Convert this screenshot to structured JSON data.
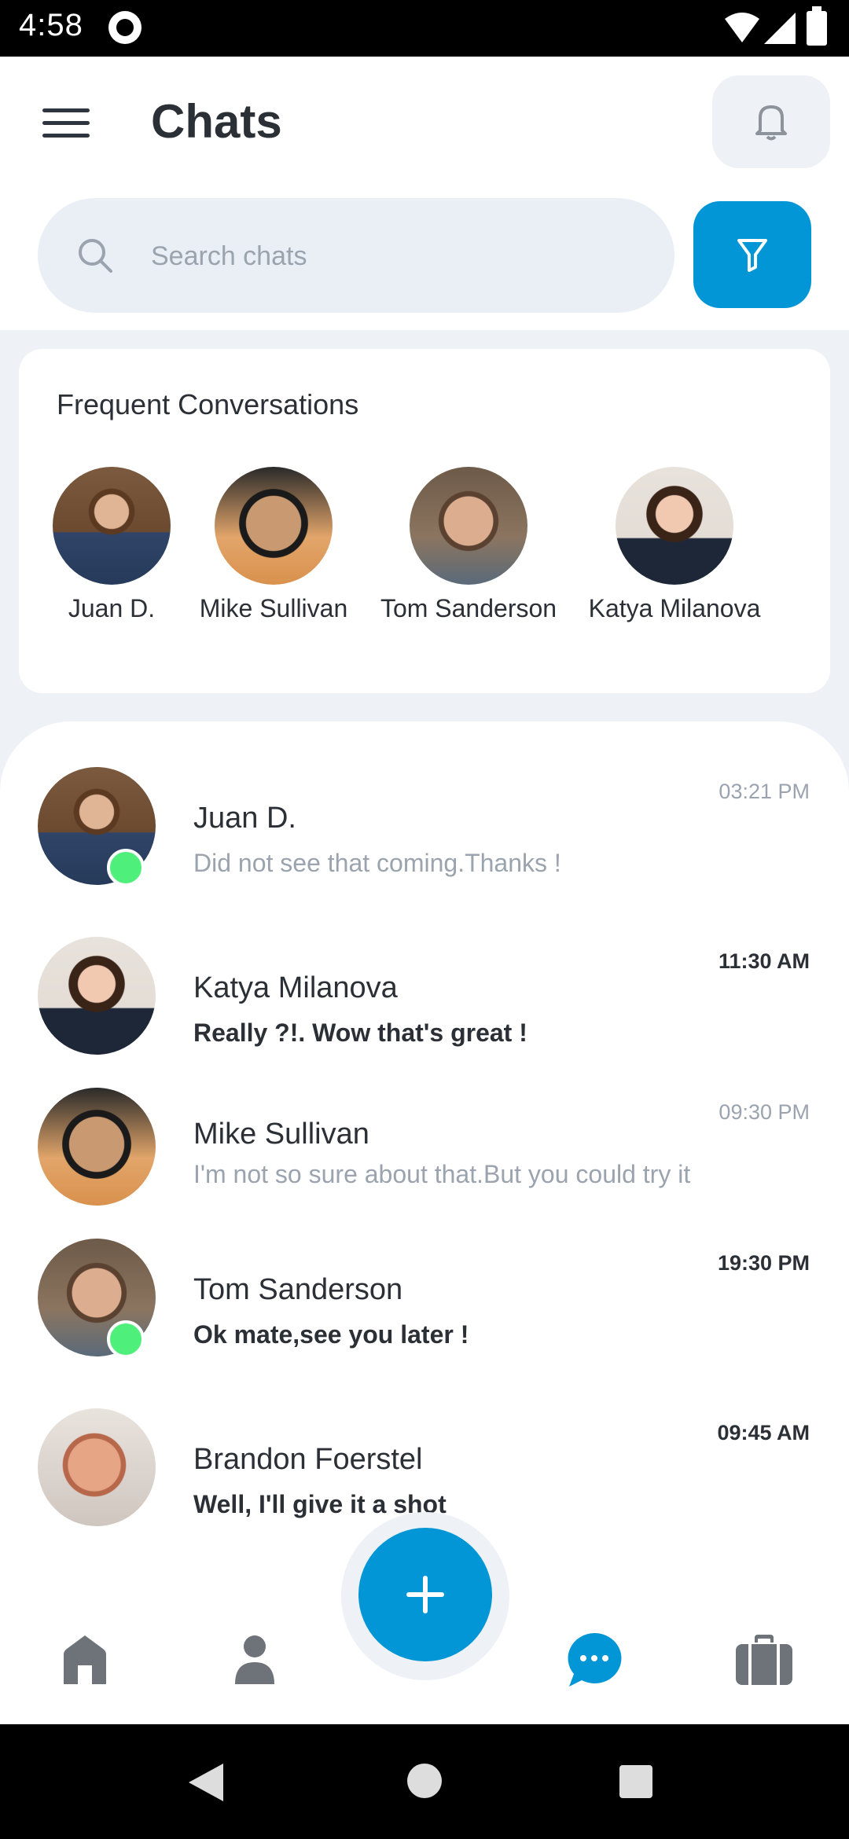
{
  "status_bar": {
    "time": "4:58"
  },
  "header": {
    "title": "Chats",
    "search_placeholder": "Search chats"
  },
  "frequent": {
    "title": "Frequent Conversations",
    "people": [
      {
        "name": "Juan D."
      },
      {
        "name": "Mike Sullivan"
      },
      {
        "name": "Tom Sanderson"
      },
      {
        "name": "Katya Milanova"
      }
    ]
  },
  "chats": [
    {
      "name": "Juan D.",
      "message": "Did not see that coming.Thanks !",
      "time": "03:21 PM",
      "unread": false,
      "online": true
    },
    {
      "name": "Katya Milanova",
      "message": "Really ?!. Wow that's great !",
      "time": "11:30 AM",
      "unread": true,
      "online": false
    },
    {
      "name": "Mike Sullivan",
      "message": "I'm not so sure about that.But you could try it",
      "time": "09:30 PM",
      "unread": false,
      "online": false
    },
    {
      "name": "Tom Sanderson",
      "message": "Ok mate,see you later !",
      "time": "19:30 PM",
      "unread": true,
      "online": true
    },
    {
      "name": "Brandon Foerstel",
      "message": "Well, I'll give it a shot",
      "time": "09:45 AM",
      "unread": true,
      "online": false
    }
  ],
  "bottom_nav": {
    "items": [
      {
        "icon": "home-icon",
        "active": false
      },
      {
        "icon": "profile-icon",
        "active": false
      },
      {
        "icon": "chat-icon",
        "active": true
      },
      {
        "icon": "briefcase-icon",
        "active": false
      }
    ]
  },
  "colors": {
    "accent": "#0396d6",
    "online": "#4ef07b",
    "inactive_icon": "#6e737a"
  }
}
